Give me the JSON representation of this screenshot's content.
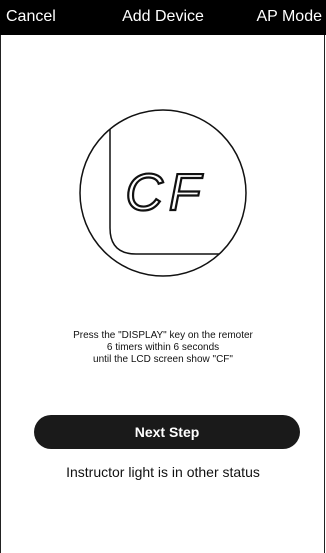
{
  "header": {
    "cancel_label": "Cancel",
    "title": "Add Device",
    "mode_label": "AP Mode"
  },
  "illustration": {
    "lcd_text": "CF"
  },
  "instructions": {
    "line1": "Press the \"DISPLAY\" key on the remoter",
    "line2": "6 timers within 6 seconds",
    "line3": "until the LCD screen show \"CF\""
  },
  "actions": {
    "next_label": "Next Step",
    "alt_status_label": "Instructor light is in other status"
  },
  "colors": {
    "header_bg": "#000000",
    "button_bg": "#1a1a1a",
    "text": "#111111"
  }
}
